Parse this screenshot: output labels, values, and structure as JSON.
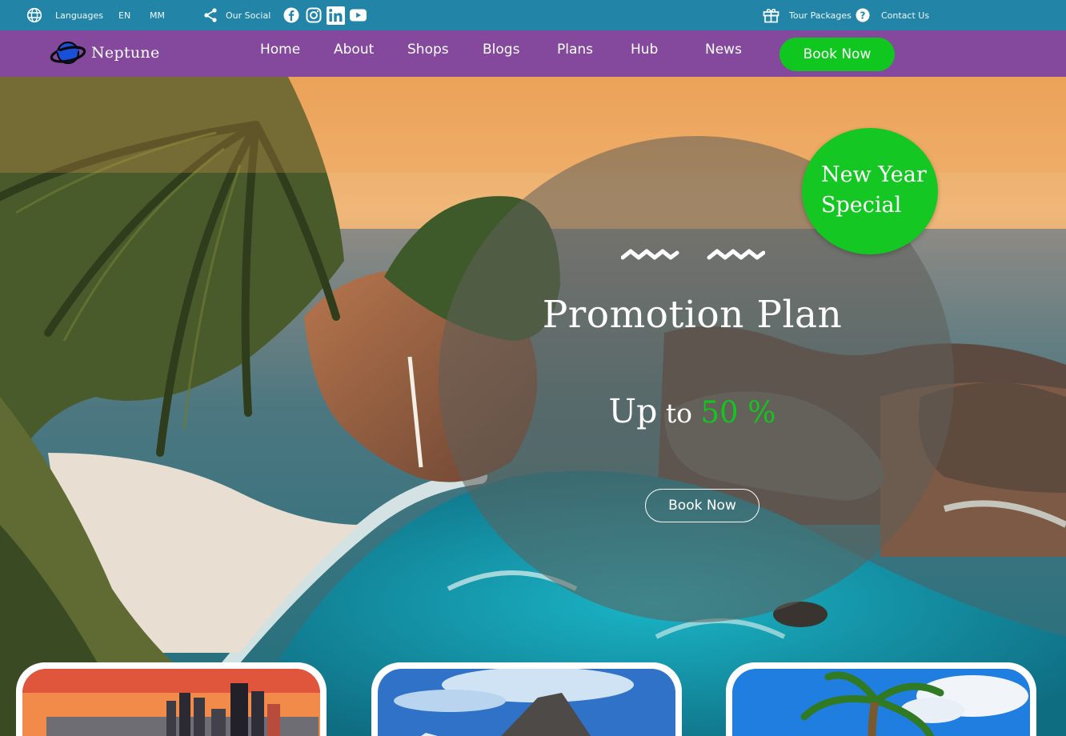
{
  "topbar": {
    "languages_label": "Languages",
    "lang_en": "EN",
    "lang_mm": "MM",
    "social_label": "Our Social",
    "tour_packages": "Tour Packages",
    "contact_us": "Contact Us",
    "social_icons": [
      "facebook-icon",
      "instagram-icon",
      "linkedin-icon",
      "youtube-icon"
    ]
  },
  "nav": {
    "brand": "Neptune",
    "links": [
      "Home",
      "About",
      "Shops",
      "Blogs",
      "Plans",
      "Hub",
      "News"
    ],
    "book_now": "Book Now"
  },
  "hero": {
    "badge_line1": "New Year",
    "badge_line2": "Special",
    "title": "Promotion Plan",
    "up": "Up",
    "to": " to ",
    "discount": "50 %",
    "book_now": "Book Now"
  },
  "colors": {
    "topbar": "#2285a8",
    "nav": "#93449e",
    "accent_green": "#10c71f",
    "planet_blue": "#1a4fd8"
  }
}
